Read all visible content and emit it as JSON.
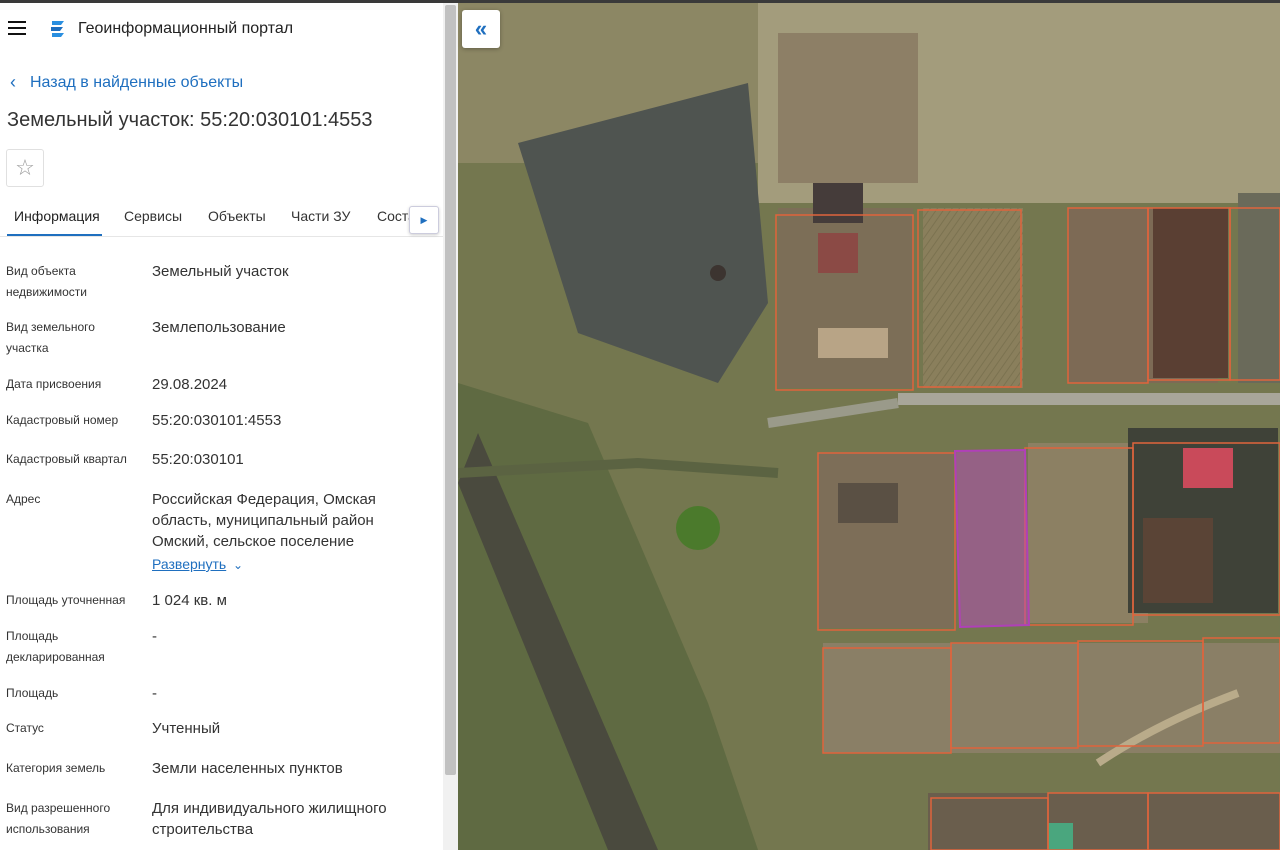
{
  "header": {
    "portal_title": "Геоинформационный портал",
    "menu_icon": "hamburger-menu-icon",
    "logo_icon": "portal-logo-icon"
  },
  "back_link": "Назад в найденные объекты",
  "object_title": "Земельный участок: 55:20:030101:4553",
  "tabs": [
    "Информация",
    "Сервисы",
    "Объекты",
    "Части ЗУ",
    "Состав"
  ],
  "details": [
    {
      "label": "Вид объекта недвижимости",
      "value": "Земельный участок"
    },
    {
      "label": "Вид земельного участка",
      "value": "Землепользование"
    },
    {
      "label": "Дата присвоения",
      "value": "29.08.2024"
    },
    {
      "label": "Кадастровый номер",
      "value": "55:20:030101:4553"
    },
    {
      "label": "Кадастровый квартал",
      "value": "55:20:030101"
    },
    {
      "label": "Адрес",
      "value": "Российская Федерация, Омская область, муниципальный район Омский, сельское поселение"
    },
    {
      "label": "Площадь уточненная",
      "value": "1 024 кв. м"
    },
    {
      "label": "Площадь декларированная",
      "value": "-"
    },
    {
      "label": "Площадь",
      "value": "-"
    },
    {
      "label": "Статус",
      "value": "Учтенный"
    },
    {
      "label": "Категория земель",
      "value": "Земли населенных пунктов"
    },
    {
      "label": "Вид разрешенного использования",
      "value": "Для индивидуального жилищного строительства"
    }
  ],
  "expand_link": "Развернуть",
  "colors": {
    "accent": "#1f6fbf",
    "parcel_border": "#e0643c",
    "selected_parcel": "#b040b8"
  }
}
